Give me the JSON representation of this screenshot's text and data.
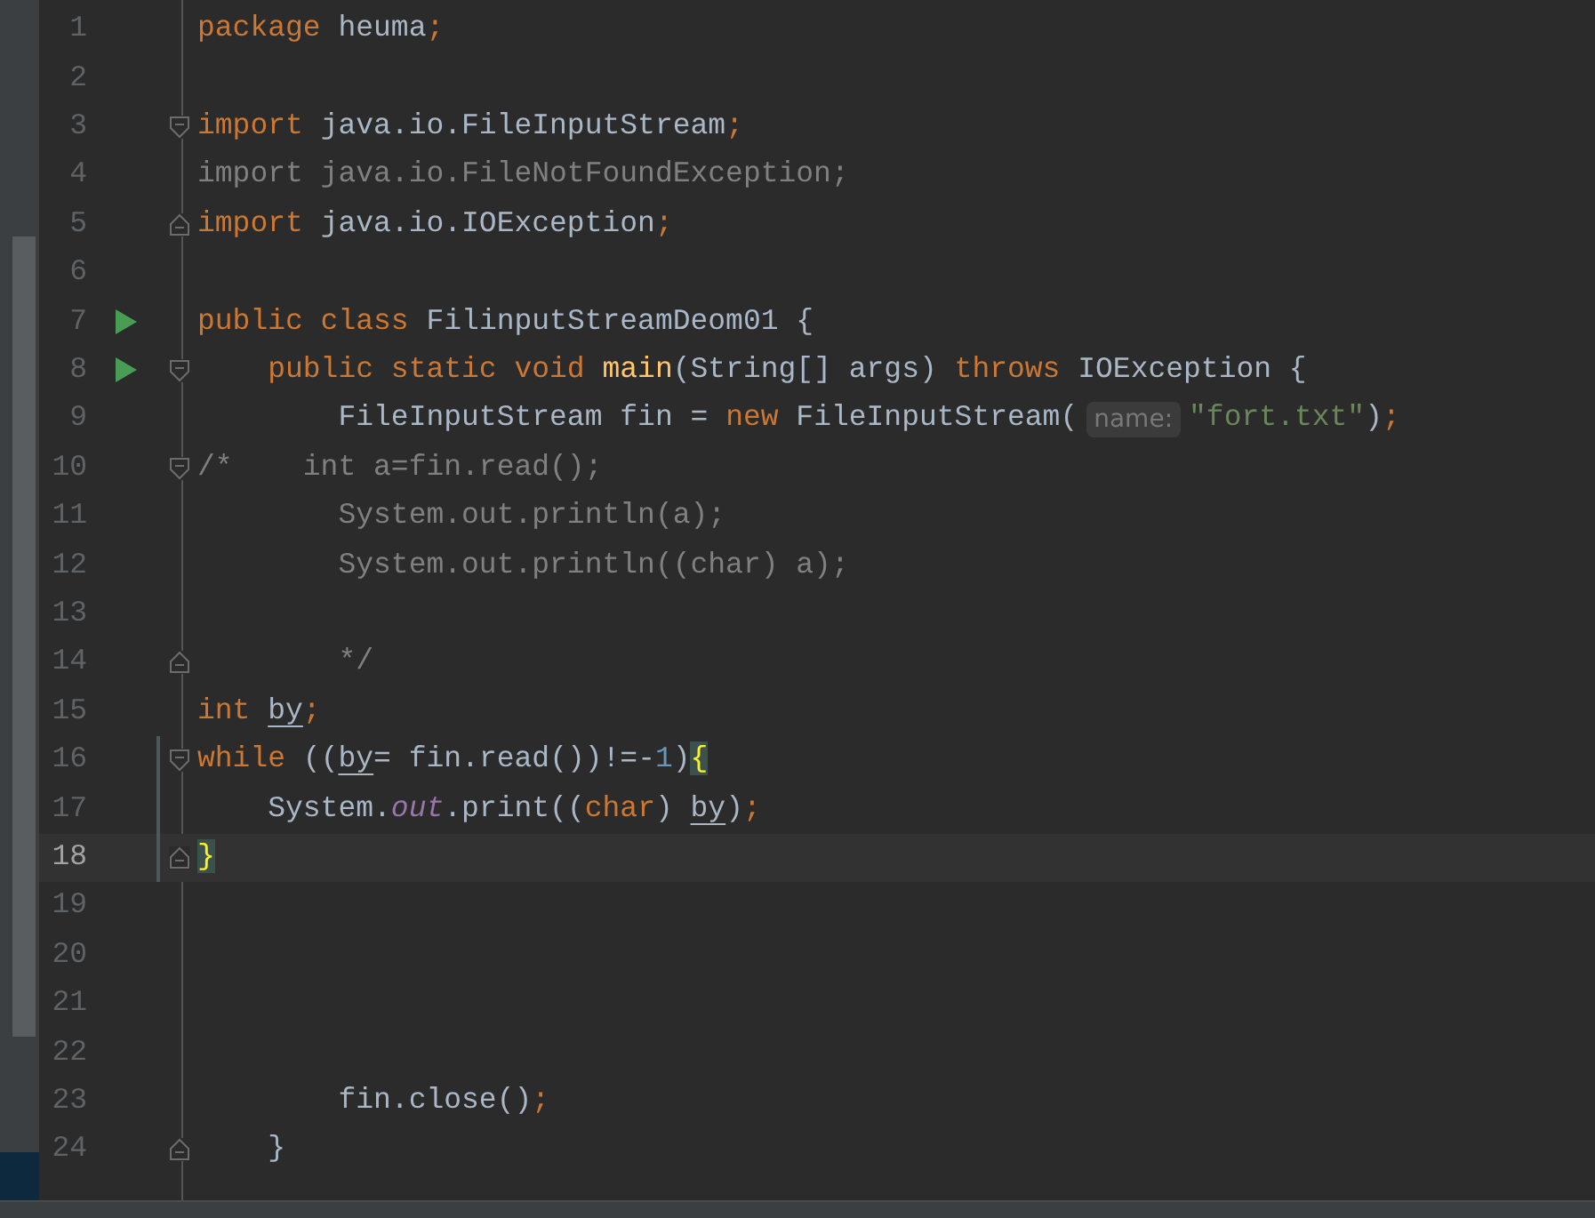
{
  "lines": [
    {
      "number": "1",
      "current": false,
      "tokens": [
        {
          "text": "package ",
          "kind": "keyword"
        },
        {
          "text": "heuma",
          "kind": "plain"
        },
        {
          "text": ";",
          "kind": "keyword"
        }
      ]
    },
    {
      "number": "2",
      "current": false
    },
    {
      "number": "3",
      "current": false,
      "fold_start": true,
      "tokens": [
        {
          "text": "import ",
          "kind": "keyword"
        },
        {
          "text": "java.io.FileInputStream",
          "kind": "plain"
        },
        {
          "text": ";",
          "kind": "keyword"
        }
      ]
    },
    {
      "number": "4",
      "current": false,
      "tokens": [
        {
          "text": "import java.io.FileNotFoundException;",
          "kind": "unused"
        }
      ]
    },
    {
      "number": "5",
      "current": false,
      "fold_end": true,
      "tokens": [
        {
          "text": "import ",
          "kind": "keyword"
        },
        {
          "text": "java.io.IOException",
          "kind": "plain"
        },
        {
          "text": ";",
          "kind": "keyword"
        }
      ]
    },
    {
      "number": "6",
      "current": false
    },
    {
      "number": "7",
      "current": false,
      "run": true,
      "tokens": [
        {
          "text": "public class ",
          "kind": "keyword"
        },
        {
          "text": "FilinputStreamDeom01 {",
          "kind": "plain"
        }
      ]
    },
    {
      "number": "8",
      "current": false,
      "run": true,
      "fold_start": true,
      "tokens": [
        {
          "text": "    public static void ",
          "kind": "keyword"
        },
        {
          "text": "main",
          "kind": "method"
        },
        {
          "text": "(String[] args) ",
          "kind": "plain"
        },
        {
          "text": "throws ",
          "kind": "keyword"
        },
        {
          "text": "IOException {",
          "kind": "plain"
        }
      ]
    },
    {
      "number": "9",
      "current": false,
      "tokens": [
        {
          "text": "        FileInputStream fin = ",
          "kind": "plain"
        },
        {
          "text": "new ",
          "kind": "keyword"
        },
        {
          "text": "FileInputStream(",
          "kind": "plain"
        },
        {
          "text": "name:",
          "kind": "hint"
        },
        {
          "text": "\"fort.txt\"",
          "kind": "string"
        },
        {
          "text": ")",
          "kind": "plain"
        },
        {
          "text": ";",
          "kind": "keyword"
        }
      ]
    },
    {
      "number": "10",
      "current": false,
      "fold_start": true,
      "tokens": [
        {
          "text": "/*    int a=fin.read();",
          "kind": "comment"
        }
      ]
    },
    {
      "number": "11",
      "current": false,
      "tokens": [
        {
          "text": "        System.out.println(a);",
          "kind": "comment"
        }
      ]
    },
    {
      "number": "12",
      "current": false,
      "tokens": [
        {
          "text": "        System.out.println((char) a);",
          "kind": "comment"
        }
      ]
    },
    {
      "number": "13",
      "current": false
    },
    {
      "number": "14",
      "current": false,
      "fold_end": true,
      "tokens": [
        {
          "text": "        */",
          "kind": "comment"
        }
      ]
    },
    {
      "number": "15",
      "current": false,
      "tokens": [
        {
          "text": "int ",
          "kind": "keyword"
        },
        {
          "text": "by",
          "kind": "variable"
        },
        {
          "text": ";",
          "kind": "keyword"
        }
      ]
    },
    {
      "number": "16",
      "current": false,
      "changed": true,
      "fold_start": true,
      "tokens": [
        {
          "text": "while ",
          "kind": "keyword"
        },
        {
          "text": "((",
          "kind": "plain"
        },
        {
          "text": "by",
          "kind": "variable"
        },
        {
          "text": "= fin.read())!=-",
          "kind": "plain"
        },
        {
          "text": "1",
          "kind": "number"
        },
        {
          "text": ")",
          "kind": "plain"
        },
        {
          "text": "{",
          "kind": "brace"
        }
      ]
    },
    {
      "number": "17",
      "current": false,
      "changed": true,
      "tokens": [
        {
          "text": "    System.",
          "kind": "plain"
        },
        {
          "text": "out",
          "kind": "field"
        },
        {
          "text": ".print((",
          "kind": "plain"
        },
        {
          "text": "char",
          "kind": "keyword"
        },
        {
          "text": ") ",
          "kind": "plain"
        },
        {
          "text": "by",
          "kind": "variable"
        },
        {
          "text": ")",
          "kind": "plain"
        },
        {
          "text": ";",
          "kind": "keyword"
        }
      ]
    },
    {
      "number": "18",
      "current": true,
      "changed": true,
      "fold_end": true,
      "tokens": [
        {
          "text": "}",
          "kind": "brace"
        }
      ]
    },
    {
      "number": "19",
      "current": false
    },
    {
      "number": "20",
      "current": false
    },
    {
      "number": "21",
      "current": false
    },
    {
      "number": "22",
      "current": false
    },
    {
      "number": "23",
      "current": false,
      "tokens": [
        {
          "text": "        fin.close()",
          "kind": "plain"
        },
        {
          "text": ";",
          "kind": "keyword"
        }
      ]
    },
    {
      "number": "24",
      "current": false,
      "fold_end": true,
      "tokens": [
        {
          "text": "    }",
          "kind": "plain"
        }
      ]
    }
  ]
}
